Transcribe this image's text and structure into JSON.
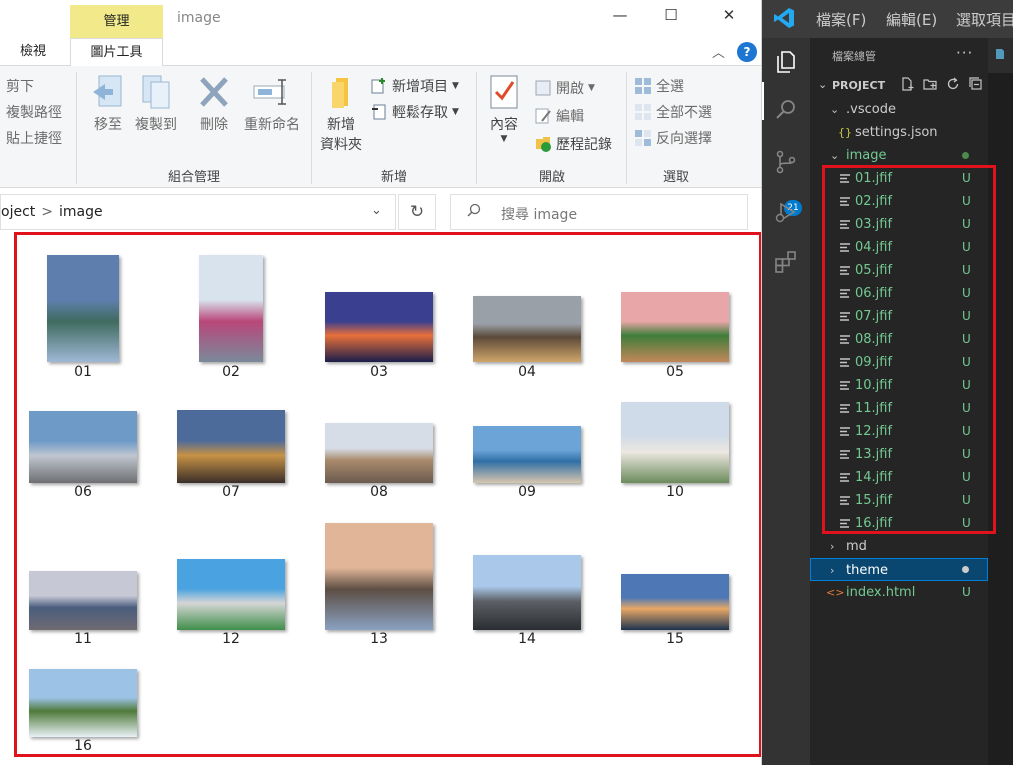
{
  "explorer": {
    "window_title": "image",
    "context_tab": "管理",
    "tabs": {
      "view": "檢視",
      "picture_tools": "圖片工具"
    },
    "ribbon": {
      "clipboard": {
        "cut": "剪下",
        "copy_path": "複製路徑",
        "paste_shortcut": "貼上捷徑"
      },
      "organize": {
        "label": "組合管理",
        "move_to": "移至",
        "copy_to": "複製到",
        "delete": "刪除",
        "rename": "重新命名"
      },
      "new": {
        "label": "新增",
        "new_folder_line1": "新增",
        "new_folder_line2": "資料夾",
        "new_item": "新增項目",
        "easy_access": "輕鬆存取"
      },
      "open": {
        "label": "開啟",
        "properties": "內容",
        "open": "開啟",
        "edit": "編輯",
        "history": "歷程記錄"
      },
      "select": {
        "label": "選取",
        "select_all": "全選",
        "select_none": "全部不選",
        "invert": "反向選擇"
      }
    },
    "address": {
      "segment1": "oject",
      "separator": ">",
      "segment2": "image"
    },
    "search_placeholder": "搜尋 image",
    "files": [
      {
        "label": "01",
        "colors": [
          "#5e7fae",
          "#3f6b5f",
          "#9fb8d6"
        ]
      },
      {
        "label": "02",
        "colors": [
          "#d9e3ee",
          "#b9477a",
          "#7a8a9a"
        ]
      },
      {
        "label": "03",
        "colors": [
          "#3b3f8f",
          "#e86f3a",
          "#1b1d4a"
        ]
      },
      {
        "label": "04",
        "colors": [
          "#9aa0a8",
          "#5b4a3a",
          "#cfa56a"
        ]
      },
      {
        "label": "05",
        "colors": [
          "#e9a6a8",
          "#3f7d3a",
          "#c2875a"
        ]
      },
      {
        "label": "06",
        "colors": [
          "#6e9ac8",
          "#bfc6cf",
          "#6d6f72"
        ]
      },
      {
        "label": "07",
        "colors": [
          "#4d6b9a",
          "#c79245",
          "#3a2e2a"
        ]
      },
      {
        "label": "08",
        "colors": [
          "#d7dde6",
          "#a98a6c",
          "#6b5b4f"
        ]
      },
      {
        "label": "09",
        "colors": [
          "#6ca4d8",
          "#2f6fa6",
          "#d7c6ae"
        ]
      },
      {
        "label": "10",
        "colors": [
          "#cfdbe8",
          "#ece7e0",
          "#6b8b5c"
        ]
      },
      {
        "label": "11",
        "colors": [
          "#c6c8d6",
          "#4a5d7d",
          "#6f6a72"
        ]
      },
      {
        "label": "12",
        "colors": [
          "#4aa3e0",
          "#d6d6d6",
          "#3f8f4a"
        ]
      },
      {
        "label": "13",
        "colors": [
          "#e0b598",
          "#5d4e44",
          "#8aa1c1"
        ]
      },
      {
        "label": "14",
        "colors": [
          "#a9c8ea",
          "#5c5f63",
          "#2a2e33"
        ]
      },
      {
        "label": "15",
        "colors": [
          "#4d78b5",
          "#e8a866",
          "#1e3350"
        ]
      },
      {
        "label": "16",
        "colors": [
          "#9cc3e6",
          "#4f7a3a",
          "#e9f1f7"
        ]
      }
    ]
  },
  "vscode": {
    "menu": {
      "file": "檔案(F)",
      "edit": "編輯(E)",
      "selection": "選取項目"
    },
    "badge_count": "21",
    "sidebar_title": "檔案總管",
    "sidebar_more": "···",
    "project_label": "PROJECT",
    "tree": {
      "vscode_folder": ".vscode",
      "settings_file": "settings.json",
      "image_folder": "image",
      "image_files": [
        {
          "name": "01.jfif",
          "status": "U"
        },
        {
          "name": "02.jfif",
          "status": "U"
        },
        {
          "name": "03.jfif",
          "status": "U"
        },
        {
          "name": "04.jfif",
          "status": "U"
        },
        {
          "name": "05.jfif",
          "status": "U"
        },
        {
          "name": "06.jfif",
          "status": "U"
        },
        {
          "name": "07.jfif",
          "status": "U"
        },
        {
          "name": "08.jfif",
          "status": "U"
        },
        {
          "name": "09.jfif",
          "status": "U"
        },
        {
          "name": "10.jfif",
          "status": "U"
        },
        {
          "name": "11.jfif",
          "status": "U"
        },
        {
          "name": "12.jfif",
          "status": "U"
        },
        {
          "name": "13.jfif",
          "status": "U"
        },
        {
          "name": "14.jfif",
          "status": "U"
        },
        {
          "name": "15.jfif",
          "status": "U"
        },
        {
          "name": "16.jfif",
          "status": "U"
        }
      ],
      "md_folder": "md",
      "theme_folder": "theme",
      "index_file": "index.html",
      "index_status": "U"
    },
    "colors": {
      "untracked_green": "#73c991",
      "accent": "#007acc",
      "selection": "#094771"
    }
  }
}
